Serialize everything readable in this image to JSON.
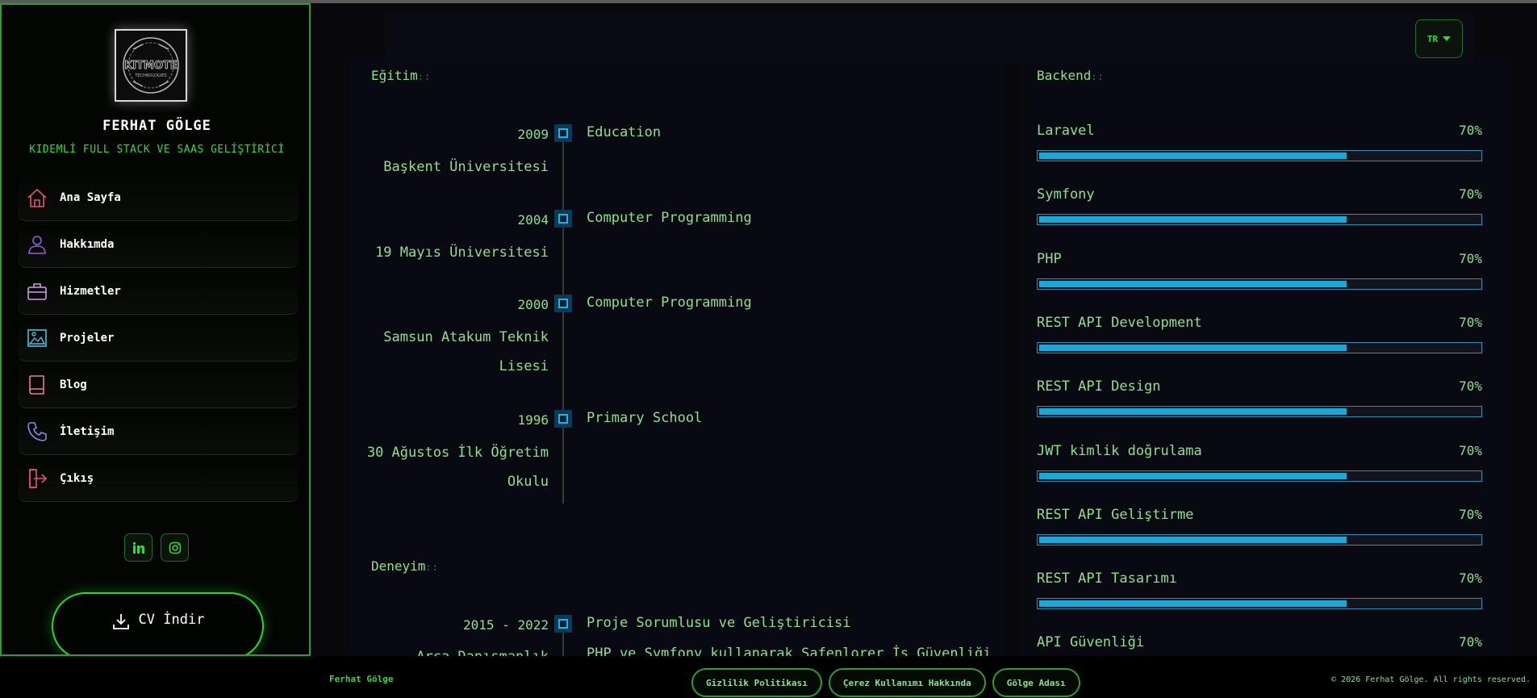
{
  "sidebar": {
    "logo_text": "KITMOTE TECHNOLOGIES",
    "name": "FERHAT GÖLGE",
    "title": "KIDEMLİ FULL STACK VE SAAS GELİŞTİRİCİ",
    "items": [
      {
        "label": "Ana Sayfa",
        "icon": "home-icon",
        "color": "#e0556f"
      },
      {
        "label": "Hakkımda",
        "icon": "user-icon",
        "color": "#a05ad8"
      },
      {
        "label": "Hizmetler",
        "icon": "briefcase-icon",
        "color": "#d49be6"
      },
      {
        "label": "Projeler",
        "icon": "image-icon",
        "color": "#46c2d8"
      },
      {
        "label": "Blog",
        "icon": "book-icon",
        "color": "#e87aa0"
      },
      {
        "label": "İletişim",
        "icon": "phone-icon",
        "color": "#8a8ae0"
      },
      {
        "label": "Çıkış",
        "icon": "logout-icon",
        "color": "#e05575"
      }
    ],
    "social": [
      {
        "icon": "linkedin-icon"
      },
      {
        "icon": "instagram-icon"
      }
    ],
    "cv_button": "CV İndir"
  },
  "header": {
    "language": "TR"
  },
  "education": {
    "title": "Eğitim",
    "entries": [
      {
        "year": "2009",
        "institution": "Başkent Üniversitesi",
        "degree": "Education"
      },
      {
        "year": "2004",
        "institution": "19 Mayıs Üniversitesi",
        "degree": "Computer Programming"
      },
      {
        "year": "2000",
        "institution": "Samsun Atakum Teknik Lisesi",
        "degree": "Computer Programming"
      },
      {
        "year": "1996",
        "institution": "30 Ağustos İlk Öğretim Okulu",
        "degree": "Primary School"
      }
    ]
  },
  "experience": {
    "title": "Deneyim",
    "entries": [
      {
        "period": "2015 - 2022",
        "company": "Arca Danışmanlık",
        "role": "Proje Sorumlusu ve Geliştiricisi",
        "description": "PHP ve Symfony kullanarak Safenlorer İş Güvenliği"
      }
    ]
  },
  "skills": {
    "title": "Backend",
    "items": [
      {
        "name": "Laravel",
        "percent": "70%",
        "level": 70
      },
      {
        "name": "Symfony",
        "percent": "70%",
        "level": 70
      },
      {
        "name": "PHP",
        "percent": "70%",
        "level": 70
      },
      {
        "name": "REST API Development",
        "percent": "70%",
        "level": 70
      },
      {
        "name": "REST API Design",
        "percent": "70%",
        "level": 70
      },
      {
        "name": "JWT kimlik doğrulama",
        "percent": "70%",
        "level": 70
      },
      {
        "name": "REST API Geliştirme",
        "percent": "70%",
        "level": 70
      },
      {
        "name": "REST API Tasarımı",
        "percent": "70%",
        "level": 70
      },
      {
        "name": "API Güvenliği",
        "percent": "70%",
        "level": 70
      }
    ]
  },
  "footer": {
    "brand": "Ferhat Gölge",
    "links": [
      "Gizlilik Politikası",
      "Çerez Kullanımı Hakkında",
      "Gölge Adası"
    ],
    "copyright": "© 2026 Ferhat Gölge. All rights reserved."
  },
  "colors": {
    "accent": "#39d739",
    "text": "#8ee08e",
    "bar_fill": "#16aadc",
    "background": "#07070c"
  }
}
